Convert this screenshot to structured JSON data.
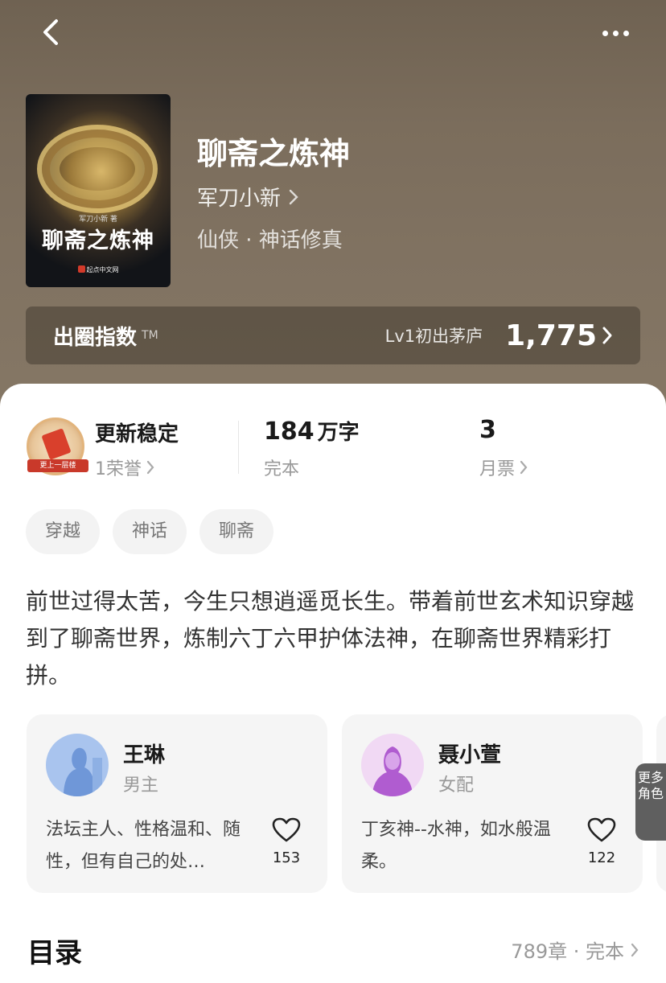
{
  "book": {
    "title": "聊斋之炼神",
    "author": "军刀小新",
    "genre": "仙侠 · 神话修真",
    "cover": {
      "title": "聊斋之炼神",
      "author": "军刀小新 著",
      "publisher": "起点中文网"
    }
  },
  "fame": {
    "label": "出圈指数",
    "tm": "TM",
    "level": "Lv1初出茅庐",
    "score": "1,775"
  },
  "stats": {
    "honor_title": "更新稳定",
    "honor_sub": "1荣誉",
    "badge_text": "更上一层楼",
    "words_num": "184",
    "words_unit": "万字",
    "words_sub": "完本",
    "tickets_num": "3",
    "tickets_sub": "月票"
  },
  "tags": [
    "穿越",
    "神话",
    "聊斋"
  ],
  "synopsis": "前世过得太苦，今生只想逍遥觅长生。带着前世玄术知识穿越到了聊斋世界，炼制六丁六甲护体法神，在聊斋世界精彩打拼。",
  "characters": [
    {
      "name": "王琳",
      "role": "男主",
      "desc": "法坛主人、性格温和、随性，但有自己的处…",
      "likes": "153"
    },
    {
      "name": "聂小萱",
      "role": "女配",
      "desc": "丁亥神--水神，如水般温柔。",
      "likes": "122"
    }
  ],
  "more_roles": "更多角色",
  "toc": {
    "title": "目录",
    "meta": "789章 · 完本"
  },
  "colors": {
    "hero": "#7b6d5c",
    "accent_red": "#d9402c",
    "muted": "#999999"
  },
  "icons": [
    "back-icon",
    "more-icon",
    "chevron-right-icon",
    "heart-icon"
  ]
}
